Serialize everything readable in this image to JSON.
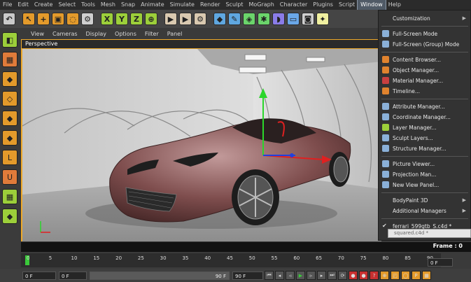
{
  "menubar": {
    "items": [
      "File",
      "Edit",
      "Create",
      "Select",
      "Tools",
      "Mesh",
      "Snap",
      "Animate",
      "Simulate",
      "Render",
      "Sculpt",
      "MoGraph",
      "Character",
      "Plugins",
      "Script",
      "Window",
      "Help"
    ],
    "active": "Window"
  },
  "toolbar": {
    "icons": [
      {
        "name": "undo-icon",
        "glyph": "↶",
        "color": "#c9c9c9"
      },
      {
        "name": "live-selection-icon",
        "glyph": "↖",
        "color": "#e39a2b"
      },
      {
        "name": "move-icon",
        "glyph": "+",
        "color": "#e39a2b"
      },
      {
        "name": "scale-icon",
        "glyph": "▣",
        "color": "#e39a2b"
      },
      {
        "name": "rotate-icon",
        "glyph": "◌",
        "color": "#e39a2b"
      },
      {
        "name": "recent-tools-icon",
        "glyph": "⚙",
        "color": "#cfcfcf"
      },
      {
        "name": "x-axis-lock-icon",
        "glyph": "X",
        "color": "#9ccf3a"
      },
      {
        "name": "y-axis-lock-icon",
        "glyph": "Y",
        "color": "#9ccf3a"
      },
      {
        "name": "z-axis-lock-icon",
        "glyph": "Z",
        "color": "#9ccf3a"
      },
      {
        "name": "world-coordinates-icon",
        "glyph": "⊕",
        "color": "#9ccf3a"
      },
      {
        "name": "render-view-icon",
        "glyph": "▶",
        "color": "#d9c9b0"
      },
      {
        "name": "render-to-picture-viewer-icon",
        "glyph": "▶",
        "color": "#d9c9b0"
      },
      {
        "name": "render-settings-icon",
        "glyph": "⚙",
        "color": "#d9c9b0"
      },
      {
        "name": "cube-object-icon",
        "glyph": "◆",
        "color": "#5fa7e0"
      },
      {
        "name": "pen-spline-icon",
        "glyph": "✎",
        "color": "#5fa7e0"
      },
      {
        "name": "subdivision-surface-icon",
        "glyph": "◈",
        "color": "#6bd46b"
      },
      {
        "name": "array-generator-icon",
        "glyph": "✱",
        "color": "#6bd46b"
      },
      {
        "name": "bend-deformer-icon",
        "glyph": "◗",
        "color": "#8a7ce8"
      },
      {
        "name": "floor-object-icon",
        "glyph": "▭",
        "color": "#6aa7e8"
      },
      {
        "name": "camera-object-icon",
        "glyph": "◙",
        "color": "#cfcfcf"
      },
      {
        "name": "light-object-icon",
        "glyph": "✦",
        "color": "#f0f0a0"
      }
    ]
  },
  "left_tools": [
    {
      "name": "make-editable-icon",
      "glyph": "◧",
      "color": "#9ccf3a"
    },
    {
      "name": "texture-mode-icon",
      "glyph": "▦",
      "color": "#e07b3a"
    },
    {
      "name": "object-mode-icon",
      "glyph": "◆",
      "color": "#e39a2b"
    },
    {
      "name": "points-mode-icon",
      "glyph": "◇",
      "color": "#e39a2b"
    },
    {
      "name": "edges-mode-icon",
      "glyph": "◆",
      "color": "#e39a2b"
    },
    {
      "name": "polygons-mode-icon",
      "glyph": "◆",
      "color": "#e39a2b"
    },
    {
      "name": "axis-mode-icon",
      "glyph": "L",
      "color": "#e39a2b"
    },
    {
      "name": "snapping-icon",
      "glyph": "U",
      "color": "#e07b3a"
    },
    {
      "name": "workplane-icon",
      "glyph": "▦",
      "color": "#9ccf3a"
    },
    {
      "name": "locked-workplane-icon",
      "glyph": "◆",
      "color": "#9ccf3a"
    }
  ],
  "viewport": {
    "menu": [
      "View",
      "Cameras",
      "Display",
      "Options",
      "Filter",
      "Panel"
    ],
    "title": "Perspective",
    "frame_label": "Frame : 0"
  },
  "timeline": {
    "ticks": [
      "0",
      "5",
      "10",
      "15",
      "20",
      "25",
      "30",
      "35",
      "40",
      "45",
      "50",
      "55",
      "60",
      "65",
      "70",
      "75",
      "80",
      "85",
      "90"
    ],
    "current_frame": "0 F"
  },
  "bottom": {
    "start_field": "0 F",
    "current_field": "0 F",
    "slider_end": "90 F",
    "end_field": "90 F"
  },
  "window_menu": {
    "items": [
      {
        "label": "Customization",
        "icon": "none",
        "arrow": true,
        "type": "item"
      },
      {
        "type": "sep"
      },
      {
        "label": "Full-Screen Mode",
        "icon": "#8ab0d8",
        "type": "item"
      },
      {
        "label": "Full-Screen (Group) Mode",
        "icon": "#8ab0d8",
        "type": "item"
      },
      {
        "type": "sep"
      },
      {
        "label": "Content Browser...",
        "icon": "#e0832e",
        "type": "item"
      },
      {
        "label": "Object Manager...",
        "icon": "#e0832e",
        "type": "item"
      },
      {
        "label": "Material Manager...",
        "icon": "#c94040",
        "type": "item"
      },
      {
        "label": "Timeline...",
        "icon": "#e0832e",
        "type": "item"
      },
      {
        "type": "sep"
      },
      {
        "label": "Attribute Manager...",
        "icon": "#8ab0d8",
        "type": "item"
      },
      {
        "label": "Coordinate Manager...",
        "icon": "#8ab0d8",
        "type": "item"
      },
      {
        "label": "Layer Manager...",
        "icon": "#9ccf3a",
        "type": "item"
      },
      {
        "label": "Sculpt Layers...",
        "icon": "#8ab0d8",
        "type": "item"
      },
      {
        "label": "Structure Manager...",
        "icon": "#8ab0d8",
        "type": "item"
      },
      {
        "type": "sep"
      },
      {
        "label": "Picture Viewer...",
        "icon": "#8ab0d8",
        "type": "item"
      },
      {
        "label": "Projection Man...",
        "icon": "#8ab0d8",
        "type": "item"
      },
      {
        "label": "New View Panel...",
        "icon": "#8ab0d8",
        "type": "item"
      },
      {
        "type": "sep"
      },
      {
        "label": "BodyPaint 3D",
        "icon": "none",
        "arrow": true,
        "type": "item"
      },
      {
        "label": "Additional Managers",
        "icon": "none",
        "arrow": true,
        "type": "item"
      },
      {
        "type": "sep"
      },
      {
        "label": "ferrari_599gtb_S.c4d *",
        "icon": "check",
        "type": "item"
      }
    ],
    "tooltip": "squared.c4d *"
  },
  "colors": {
    "accent": "#eea92a",
    "menu_bg": "#333333",
    "car_body": "#8a5a5a"
  }
}
